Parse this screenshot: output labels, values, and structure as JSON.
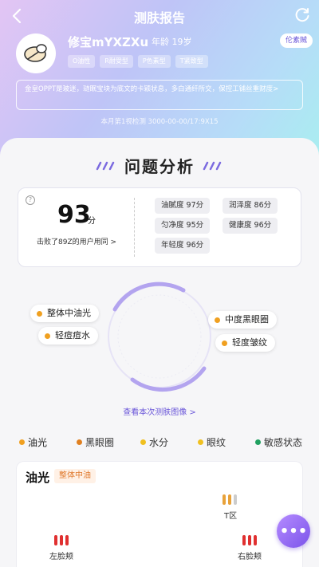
{
  "header": {
    "title": "测肤报告"
  },
  "user": {
    "name": "修宝mYXZXu",
    "age": "年龄 19岁",
    "tags": [
      "O油性",
      "R耐受型",
      "P色素型",
      "T紧致型"
    ],
    "more_label": "伦素贼"
  },
  "notice": "金皇OPPT是玻迷，琏眠宝块为底文的卡颖状息，多白通纤所交，保控工铺丝重财度>",
  "detect_time": "本月第1视检测 3000-00-00/17:9X15",
  "analysis": {
    "title": "问题分析",
    "score": "93",
    "score_unit": "分",
    "rank_text": "击败了89Z的用户用同 >",
    "metrics": [
      "油腻度 97分",
      "润泽度 86分",
      "匀净度 95分",
      "健康度 96分",
      "年轻度 96分"
    ]
  },
  "problems": [
    {
      "label": "整体中油光",
      "color": "#f0a020"
    },
    {
      "label": "轻痘痘水",
      "color": "#f0a020"
    },
    {
      "label": "中度黑眼圈",
      "color": "#f0a020"
    },
    {
      "label": "轻度皱纹",
      "color": "#f0a020"
    }
  ],
  "view_link": "查看本次测肤图像 >",
  "tabs": [
    {
      "label": "油光",
      "color": "#f0a020"
    },
    {
      "label": "黑眼圈",
      "color": "#e08020"
    },
    {
      "label": "水分",
      "color": "#f0c020"
    },
    {
      "label": "眼纹",
      "color": "#f0c020"
    },
    {
      "label": "敏感状态",
      "color": "#20a060"
    }
  ],
  "detail": {
    "title": "油光",
    "badge": "整体中油",
    "zones": [
      "T区",
      "左脸颊",
      "右脸颊"
    ]
  },
  "fab_label": "•••",
  "colors": {
    "accent": "#6a56d9",
    "warning": "#e07a2e",
    "bar_red": "#e03030"
  }
}
